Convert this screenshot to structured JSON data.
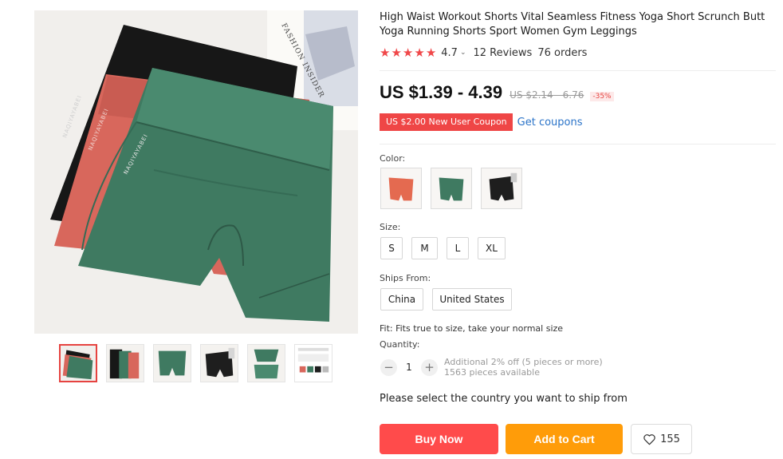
{
  "product": {
    "title": "High Waist Workout Shorts Vital Seamless Fitness Yoga Short Scrunch Butt Yoga Running Shorts Sport Women Gym Leggings",
    "rating": "4.7",
    "rating_stars": 5,
    "reviews": "12 Reviews",
    "orders": "76 orders",
    "price": "US $1.39 - 4.39",
    "original_price": "US $2.14 - 6.76",
    "discount": "-35%",
    "coupon": "US $2.00 New User Coupon",
    "get_coupons": "Get coupons",
    "brand_print": "NAQIYAYABEI",
    "backdrop_text": "FASHION INSIDER"
  },
  "color": {
    "label": "Color:",
    "options": [
      {
        "name": "coral",
        "hex": "#e46a50"
      },
      {
        "name": "green",
        "hex": "#3f7a61"
      },
      {
        "name": "black",
        "hex": "#1e1e1e"
      }
    ]
  },
  "size": {
    "label": "Size:",
    "options": [
      "S",
      "M",
      "L",
      "XL"
    ]
  },
  "ships_from": {
    "label": "Ships From:",
    "options": [
      "China",
      "United States"
    ]
  },
  "fit": "Fit: Fits true to size, take your normal size",
  "quantity": {
    "label": "Quantity:",
    "value": "1",
    "minus_icon": "minus-icon",
    "plus_icon": "plus-icon",
    "note": "Additional 2% off (5 pieces or more)",
    "available": "1563 pieces available"
  },
  "ship_message": "Please select the country you want to ship from",
  "actions": {
    "buy_now": "Buy Now",
    "add_to_cart": "Add to Cart",
    "wishlist_count": "155",
    "wishlist_icon": "heart-icon"
  },
  "gallery": {
    "thumb_count": 6,
    "active_index": 0
  },
  "colors": {
    "accent": "#ff4b4b",
    "cart": "#ff9c09",
    "star": "#f0484a",
    "link": "#2a73c8"
  }
}
